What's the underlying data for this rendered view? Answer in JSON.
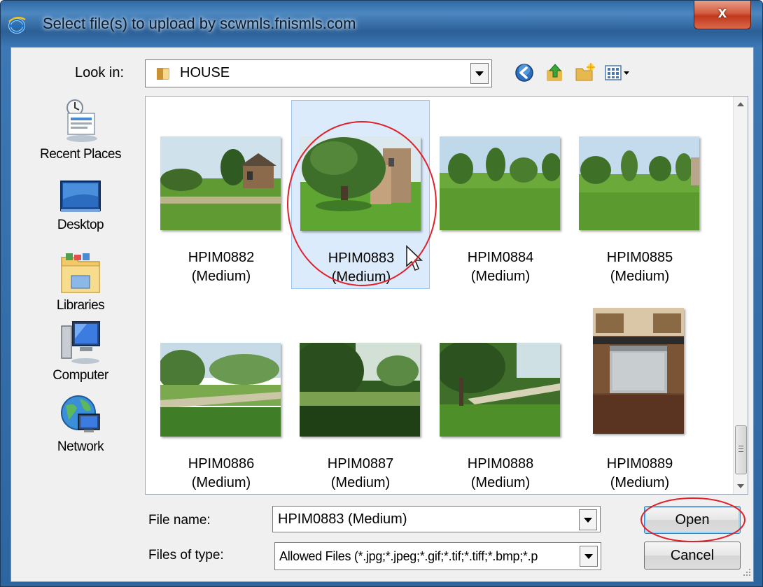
{
  "dialog": {
    "title": "Select file(s) to upload by scwmls.fnismls.com",
    "close_label": "x"
  },
  "lookin": {
    "label": "Look in:",
    "value": "HOUSE"
  },
  "places": [
    {
      "label": "Recent Places",
      "icon": "recent-places-icon"
    },
    {
      "label": "Desktop",
      "icon": "desktop-icon"
    },
    {
      "label": "Libraries",
      "icon": "libraries-icon"
    },
    {
      "label": "Computer",
      "icon": "computer-icon"
    },
    {
      "label": "Network",
      "icon": "network-icon"
    }
  ],
  "files": [
    {
      "name": "HPIM0882",
      "size": "(Medium)",
      "selected": false
    },
    {
      "name": "HPIM0883",
      "size": "(Medium)",
      "selected": true
    },
    {
      "name": "HPIM0884",
      "size": "(Medium)",
      "selected": false
    },
    {
      "name": "HPIM0885",
      "size": "(Medium)",
      "selected": false
    },
    {
      "name": "HPIM0886",
      "size": "(Medium)",
      "selected": false
    },
    {
      "name": "HPIM0887",
      "size": "(Medium)",
      "selected": false
    },
    {
      "name": "HPIM0888",
      "size": "(Medium)",
      "selected": false
    },
    {
      "name": "HPIM0889",
      "size": "(Medium)",
      "selected": false
    }
  ],
  "form": {
    "filename_label": "File name:",
    "filename_value": "HPIM0883 (Medium)",
    "filetype_label": "Files of type:",
    "filetype_value": "Allowed Files (*.jpg;*.jpeg;*.gif;*.tif;*.tiff;*.bmp;*.p"
  },
  "buttons": {
    "open": "Open",
    "cancel": "Cancel"
  },
  "colors": {
    "selection": "#dcebfb",
    "annotation": "#e0202a",
    "title_bar": "#2f6aa6"
  }
}
